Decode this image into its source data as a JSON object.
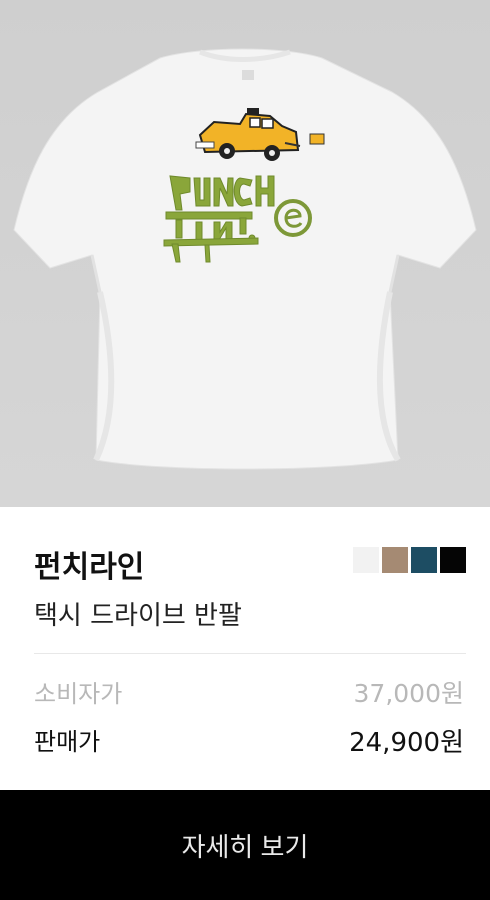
{
  "product": {
    "brand": "펀치라인",
    "name": "택시 드라이브 반팔",
    "image_alt": "white tshirt",
    "colors": [
      "#f2f2f2",
      "#a58a73",
      "#1d4d63",
      "#050505"
    ]
  },
  "pricing": {
    "retail_label": "소비자가",
    "retail_price": "37,000원",
    "sale_label": "판매가",
    "sale_price": "24,900원"
  },
  "cta": {
    "label": "자세히 보기"
  }
}
